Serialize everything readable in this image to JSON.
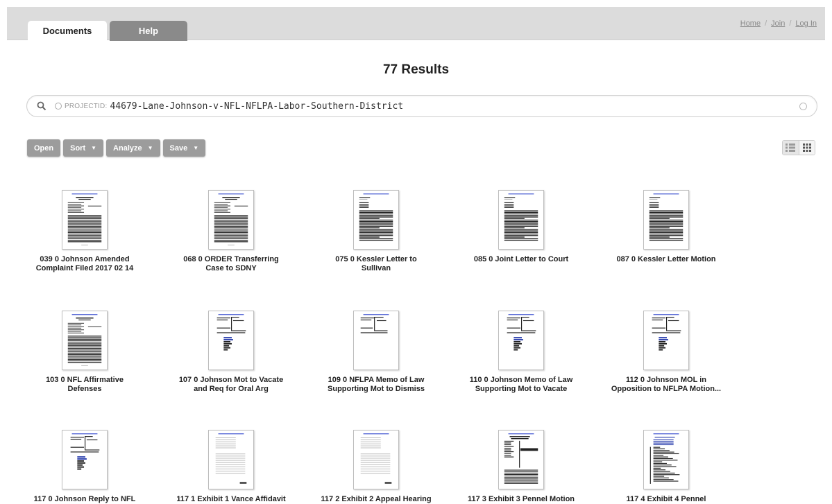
{
  "tabs": {
    "documents": "Documents",
    "help": "Help"
  },
  "toplinks": {
    "home": "Home",
    "join": "Join",
    "login": "Log In",
    "separator": "/"
  },
  "results_title": "77 Results",
  "search": {
    "token_key": "PROJECTID:",
    "token_value": "44679-Lane-Johnson-v-NFL-NFLPA-Labor-Southern-District"
  },
  "toolbar": {
    "open": "Open",
    "sort": "Sort",
    "analyze": "Analyze",
    "save": "Save",
    "caret": "▼"
  },
  "documents": [
    {
      "line1": "039 0 Johnson Amended",
      "line2": "Complaint Filed 2017 02 14",
      "style": "dense"
    },
    {
      "line1": "068 0 ORDER Transferring",
      "line2": "Case to SDNY",
      "style": "dense"
    },
    {
      "line1": "075 0 Kessler Letter to",
      "line2": "Sullivan",
      "style": "letter"
    },
    {
      "line1": "085 0 Joint Letter to Court",
      "line2": "",
      "style": "letter"
    },
    {
      "line1": "087 0 Kessler Letter Motion",
      "line2": "",
      "style": "letter"
    },
    {
      "line1": "103 0 NFL Affirmative",
      "line2": "Defenses",
      "style": "dense"
    },
    {
      "line1": "107 0 Johnson Mot to Vacate",
      "line2": "and Req for Oral Arg",
      "style": "caption"
    },
    {
      "line1": "109 0 NFLPA Memo of Law",
      "line2": "Supporting Mot to Dismiss",
      "style": "captionbare"
    },
    {
      "line1": "110 0 Johnson Memo of Law",
      "line2": "Supporting Mot to Vacate",
      "style": "caption"
    },
    {
      "line1": "112 0 Johnson MOL in",
      "line2": "Opposition to NFLPA Motion...",
      "style": "caption"
    },
    {
      "line1": "117 0 Johnson Reply to NFL",
      "line2": "",
      "style": "caption"
    },
    {
      "line1": "117 1 Exhibit 1 Vance Affidavit",
      "line2": "",
      "style": "faint"
    },
    {
      "line1": "117 2 Exhibit 2 Appeal Hearing",
      "line2": "",
      "style": "faint"
    },
    {
      "line1": "117 3 Exhibit 3 Pennel Motion",
      "line2": "",
      "style": "motion"
    },
    {
      "line1": "117 4 Exhibit 4 Pennel",
      "line2": "",
      "style": "list"
    }
  ]
}
